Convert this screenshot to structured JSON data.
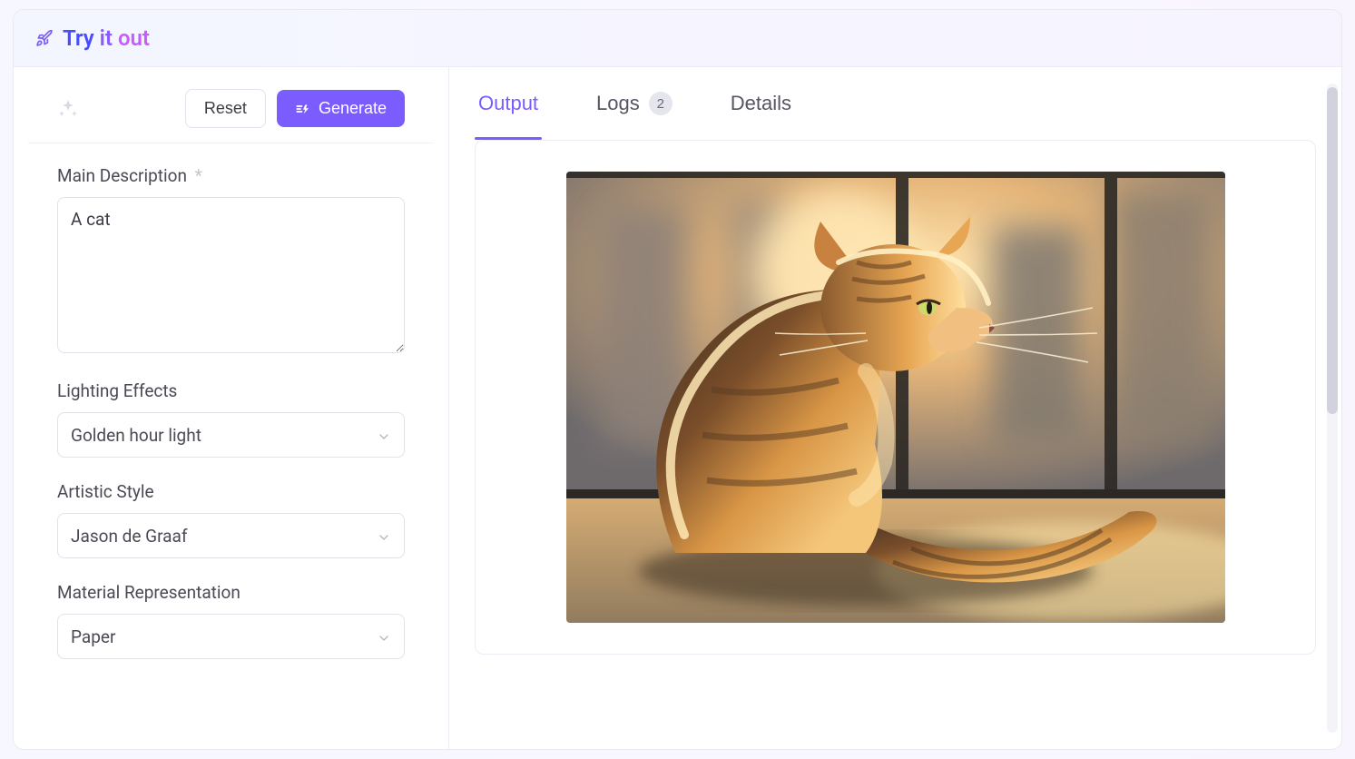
{
  "header": {
    "title_try": "Try",
    "title_it": "it",
    "title_out": "out"
  },
  "toolbar": {
    "reset_label": "Reset",
    "generate_label": "Generate"
  },
  "form": {
    "main_description": {
      "label": "Main Description",
      "required_mark": "*",
      "value": "A cat"
    },
    "lighting_effects": {
      "label": "Lighting Effects",
      "value": "Golden hour light"
    },
    "artistic_style": {
      "label": "Artistic Style",
      "value": "Jason de Graaf"
    },
    "material_representation": {
      "label": "Material Representation",
      "value": "Paper"
    }
  },
  "tabs": {
    "output": "Output",
    "logs": "Logs",
    "logs_count": "2",
    "details": "Details",
    "active": "output"
  }
}
